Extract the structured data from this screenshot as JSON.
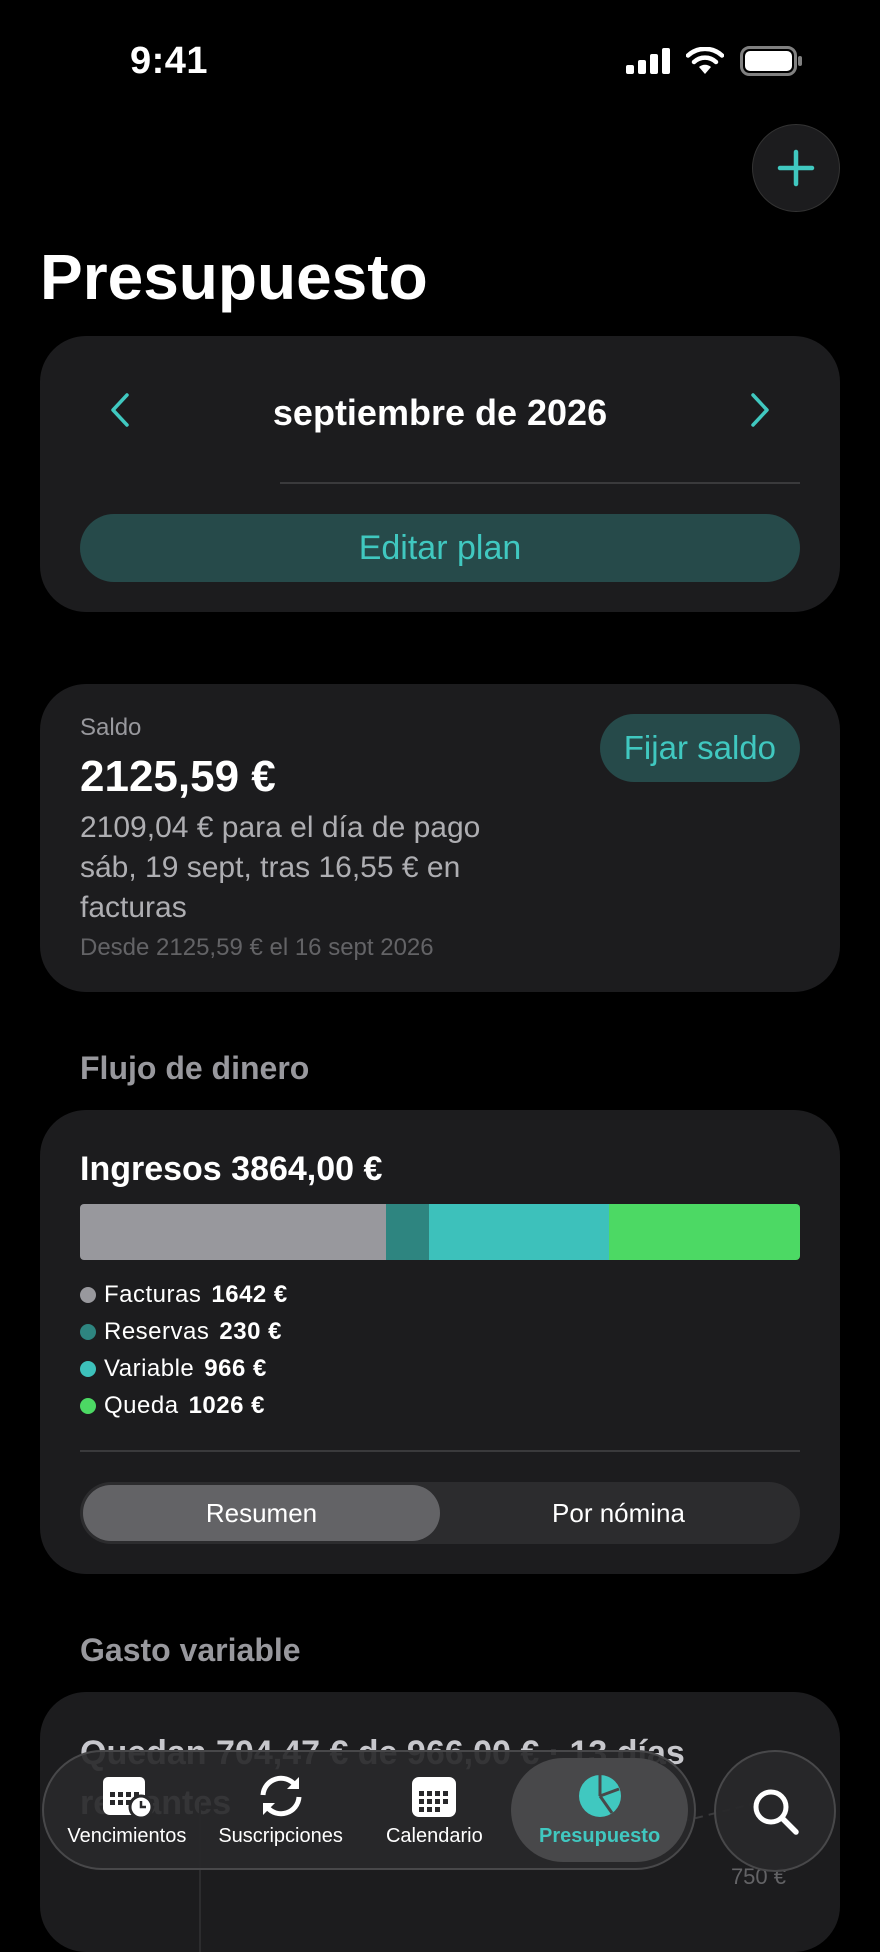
{
  "status_bar": {
    "time": "9:41"
  },
  "header": {
    "title": "Presupuesto"
  },
  "month_selector": {
    "label": "septiembre de 2026",
    "edit_plan_label": "Editar plan"
  },
  "balance": {
    "label": "Saldo",
    "amount": "2125,59 €",
    "description": "2109,04 € para el día de pago sáb, 19 sept, tras 16,55 € en facturas",
    "since": "Desde 2125,59 € el 16 sept 2026",
    "set_balance_label": "Fijar saldo"
  },
  "cash_flow": {
    "section_title": "Flujo de dinero",
    "income_label": "Ingresos 3864,00 €",
    "segments": [
      {
        "name": "Facturas",
        "value": "1642 €",
        "amount": 1642,
        "color": "#98989d"
      },
      {
        "name": "Reservas",
        "value": "230 €",
        "amount": 230,
        "color": "#2e8580"
      },
      {
        "name": "Variable",
        "value": "966 €",
        "amount": 966,
        "color": "#3dc1bb"
      },
      {
        "name": "Queda",
        "value": "1026 €",
        "amount": 1026,
        "color": "#4cd964"
      }
    ],
    "view_options": [
      "Resumen",
      "Por nómina"
    ],
    "selected_view": "Resumen"
  },
  "variable_spending": {
    "section_title": "Gasto variable",
    "summary": "Quedan 704,47 € de 966,00 € · 13 días restantes",
    "axis_label": "750 €"
  },
  "tab_bar": {
    "items": [
      {
        "label": "Vencimientos",
        "icon": "calendar-clock-icon"
      },
      {
        "label": "Suscripciones",
        "icon": "refresh-icon"
      },
      {
        "label": "Calendario",
        "icon": "calendar-icon"
      },
      {
        "label": "Presupuesto",
        "icon": "pie-chart-icon"
      }
    ],
    "active": "Presupuesto"
  },
  "colors": {
    "accent": "#40c8c0",
    "card": "#1c1c1e",
    "background": "#000000"
  }
}
